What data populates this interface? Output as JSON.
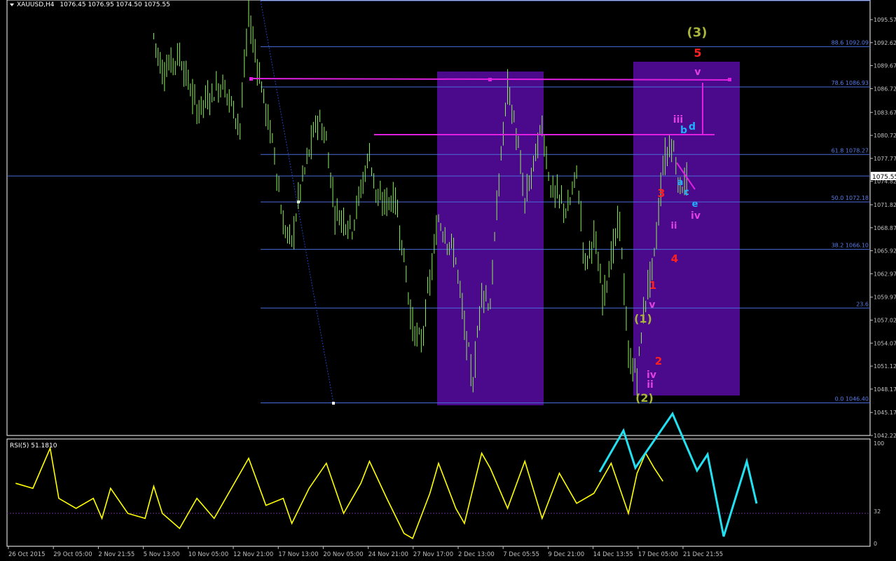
{
  "header": {
    "symbol_label": "XAUUSD,H4",
    "ohlc": "1076.45 1076.95 1074.50 1075.55",
    "rsi_label": "RSI(5) 51.1810"
  },
  "price_axis": {
    "ticks": [
      "1095.57",
      "1092.62",
      "1089.67",
      "1086.72",
      "1083.67",
      "1080.72",
      "1077.77",
      "1074.82",
      "1071.82",
      "1068.87",
      "1065.92",
      "1062.97",
      "1059.97",
      "1057.02",
      "1054.07",
      "1051.12",
      "1048.17",
      "1045.17",
      "1042.22"
    ],
    "current_price": "1075.55"
  },
  "rsi_axis": {
    "ticks": [
      "100",
      "32",
      "0"
    ]
  },
  "time_axis": {
    "labels": [
      "26 Oct 2015",
      "29 Oct 05:00",
      "2 Nov 21:55",
      "5 Nov 13:00",
      "10 Nov 05:00",
      "12 Nov 21:00",
      "17 Nov 13:00",
      "20 Nov 05:00",
      "24 Nov 21:00",
      "27 Nov 17:00",
      "2 Dec 13:00",
      "7 Dec 05:55",
      "9 Dec 21:00",
      "14 Dec 13:55",
      "17 Dec 05:00",
      "21 Dec 21:55"
    ]
  },
  "fib_levels": [
    {
      "label": "88.6 1092.09",
      "price": 1092.09
    },
    {
      "label": "78.6 1086.93",
      "price": 1086.93
    },
    {
      "label": "61.8 1078.27",
      "price": 1078.27
    },
    {
      "label": "50.0 1072.18",
      "price": 1072.18
    },
    {
      "label": "38.2 1066.10",
      "price": 1066.1
    },
    {
      "label": "23.6",
      "price": 1058.57
    },
    {
      "label": "0.0 1046.40",
      "price": 1046.4
    }
  ],
  "wave_labels": [
    {
      "text": "(3)",
      "color": "#a9b43c"
    },
    {
      "text": "5",
      "color": "#ff2020"
    },
    {
      "text": "v",
      "color": "#e040e0"
    },
    {
      "text": "iii",
      "color": "#e040e0"
    },
    {
      "text": "b",
      "color": "#20b0ff"
    },
    {
      "text": "d",
      "color": "#20b0ff"
    },
    {
      "text": "a",
      "color": "#20b0ff"
    },
    {
      "text": "c",
      "color": "#20b0ff"
    },
    {
      "text": "e",
      "color": "#20b0ff"
    },
    {
      "text": "iv",
      "color": "#e040e0"
    },
    {
      "text": "3",
      "color": "#ff2020"
    },
    {
      "text": "ii",
      "color": "#e040e0"
    },
    {
      "text": "4",
      "color": "#ff2020"
    },
    {
      "text": "1",
      "color": "#ff2020"
    },
    {
      "text": "v",
      "color": "#e040e0"
    },
    {
      "text": "(1)",
      "color": "#a9b43c"
    },
    {
      "text": "2",
      "color": "#ff2020"
    },
    {
      "text": "iv",
      "color": "#e040e0"
    },
    {
      "text": "ii",
      "color": "#e040e0"
    },
    {
      "text": "(2)",
      "color": "#a9b43c"
    }
  ],
  "colors": {
    "background": "#000000",
    "candle": "#8fef5a",
    "fib": "#4a6cd8",
    "zone": "#4b0a8c",
    "magenta": "#e020e0",
    "rsi": "#ffff00",
    "projection": "#22e0f0",
    "axis_text": "#c0c0c0"
  },
  "chart_data": {
    "type": "line",
    "symbol": "XAUUSD",
    "timeframe": "H4",
    "x": [
      "26 Oct 2015",
      "29 Oct 05:00",
      "2 Nov 21:55",
      "5 Nov 13:00",
      "10 Nov 05:00",
      "12 Nov 21:00",
      "17 Nov 13:00",
      "20 Nov 05:00",
      "24 Nov 21:00",
      "27 Nov 17:00",
      "2 Dec 13:00",
      "7 Dec 05:55",
      "9 Dec 21:00",
      "14 Dec 13:55",
      "17 Dec 05:00",
      "21 Dec 21:55"
    ],
    "price_range": [
      1042.22,
      1095.57
    ],
    "rsi_range": [
      0,
      100
    ],
    "price_path": [
      [
        0.17,
        1093.5
      ],
      [
        0.18,
        1089.0
      ],
      [
        0.2,
        1091.0
      ],
      [
        0.22,
        1084.0
      ],
      [
        0.25,
        1087.5
      ],
      [
        0.27,
        1082.0
      ],
      [
        0.28,
        1096.0
      ],
      [
        0.3,
        1084.0
      ],
      [
        0.31,
        1078.5
      ],
      [
        0.32,
        1069.0
      ],
      [
        0.33,
        1067.0
      ],
      [
        0.34,
        1074.0
      ],
      [
        0.36,
        1083.0
      ],
      [
        0.37,
        1080.0
      ],
      [
        0.38,
        1071.0
      ],
      [
        0.4,
        1069.0
      ],
      [
        0.42,
        1078.5
      ],
      [
        0.43,
        1072.0
      ],
      [
        0.45,
        1072.5
      ],
      [
        0.46,
        1065.0
      ],
      [
        0.47,
        1056.0
      ],
      [
        0.48,
        1054.0
      ],
      [
        0.5,
        1070.0
      ],
      [
        0.52,
        1065.0
      ],
      [
        0.53,
        1056.0
      ],
      [
        0.54,
        1049.0
      ],
      [
        0.55,
        1061.0
      ],
      [
        0.56,
        1059.0
      ],
      [
        0.57,
        1075.0
      ],
      [
        0.58,
        1087.0
      ],
      [
        0.59,
        1081.0
      ],
      [
        0.6,
        1072.0
      ],
      [
        0.62,
        1082.0
      ],
      [
        0.63,
        1074.0
      ],
      [
        0.65,
        1071.0
      ],
      [
        0.66,
        1076.0
      ],
      [
        0.67,
        1064.0
      ],
      [
        0.68,
        1068.0
      ],
      [
        0.69,
        1060.0
      ],
      [
        0.71,
        1070.0
      ],
      [
        0.72,
        1052.0
      ],
      [
        0.73,
        1050.0
      ],
      [
        0.74,
        1060.0
      ],
      [
        0.75,
        1065.0
      ],
      [
        0.76,
        1077.0
      ],
      [
        0.77,
        1080.0
      ],
      [
        0.78,
        1074.0
      ],
      [
        0.79,
        1075.5
      ]
    ],
    "rsi_path": [
      [
        0.01,
        60
      ],
      [
        0.03,
        55
      ],
      [
        0.05,
        95
      ],
      [
        0.06,
        45
      ],
      [
        0.08,
        35
      ],
      [
        0.1,
        45
      ],
      [
        0.11,
        25
      ],
      [
        0.12,
        55
      ],
      [
        0.14,
        30
      ],
      [
        0.16,
        25
      ],
      [
        0.17,
        57
      ],
      [
        0.18,
        30
      ],
      [
        0.2,
        15
      ],
      [
        0.22,
        45
      ],
      [
        0.24,
        25
      ],
      [
        0.26,
        55
      ],
      [
        0.28,
        85
      ],
      [
        0.3,
        38
      ],
      [
        0.32,
        45
      ],
      [
        0.33,
        20
      ],
      [
        0.35,
        55
      ],
      [
        0.37,
        80
      ],
      [
        0.39,
        30
      ],
      [
        0.41,
        60
      ],
      [
        0.42,
        82
      ],
      [
        0.44,
        45
      ],
      [
        0.46,
        10
      ],
      [
        0.47,
        5
      ],
      [
        0.49,
        50
      ],
      [
        0.5,
        80
      ],
      [
        0.52,
        35
      ],
      [
        0.53,
        20
      ],
      [
        0.55,
        90
      ],
      [
        0.56,
        75
      ],
      [
        0.58,
        35
      ],
      [
        0.6,
        82
      ],
      [
        0.62,
        25
      ],
      [
        0.64,
        70
      ],
      [
        0.66,
        40
      ],
      [
        0.68,
        50
      ],
      [
        0.7,
        80
      ],
      [
        0.72,
        30
      ],
      [
        0.73,
        70
      ],
      [
        0.74,
        90
      ],
      [
        0.75,
        75
      ],
      [
        0.76,
        62
      ]
    ],
    "rsi_level": 32,
    "projection": [
      [
        1.0,
        0
      ],
      [
        0.88,
        0
      ],
      [
        0.92,
        0
      ]
    ]
  }
}
